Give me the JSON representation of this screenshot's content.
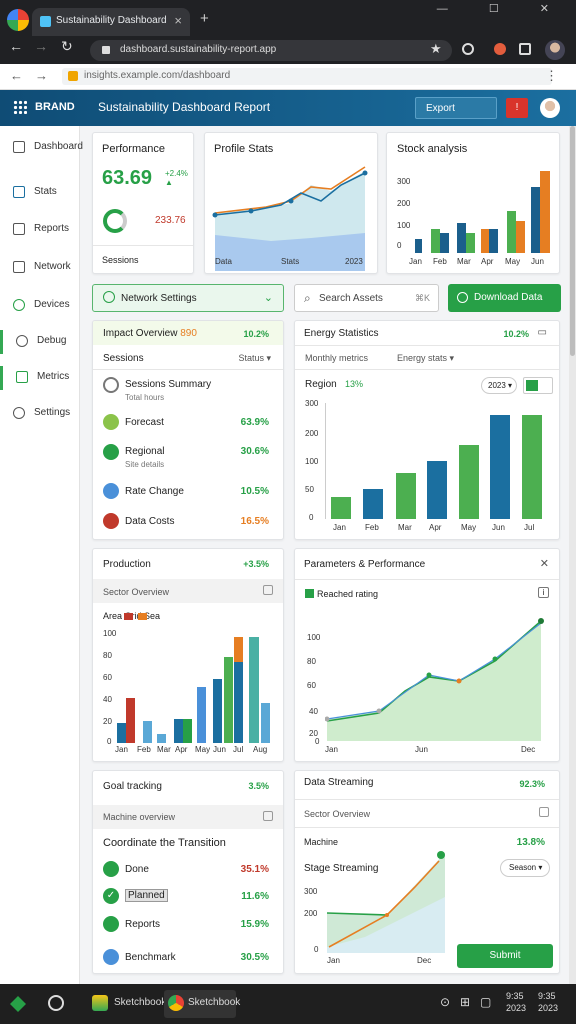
{
  "browser": {
    "tab_title": "Sustainability Dashboard",
    "url": "dashboard.sustainability-report.app",
    "window_controls": "— ☐ ✕"
  },
  "subbar": {
    "url": "insights.example.com/dashboard"
  },
  "header": {
    "brand": "BRAND",
    "title": "Sustainability Dashboard Report",
    "button_label": "Export",
    "alert_label": "!"
  },
  "sidebar": {
    "items": [
      {
        "label": "Dashboard",
        "icon": "dashboard-icon"
      },
      {
        "label": "Stats",
        "icon": "stats-icon"
      },
      {
        "label": "Reports",
        "icon": "reports-icon"
      },
      {
        "label": "Network",
        "icon": "network-icon"
      },
      {
        "label": "Devices",
        "icon": "devices-icon"
      },
      {
        "label": "Debug",
        "icon": "debug-icon"
      },
      {
        "label": "Metrics",
        "icon": "metrics-icon"
      },
      {
        "label": "Settings",
        "icon": "settings-icon"
      }
    ]
  },
  "card_overview": {
    "title": "Performance",
    "value": "63.69",
    "delta": "+2.4% ▲",
    "stat": "233.76",
    "footer": "Sessions"
  },
  "card_trend": {
    "title": "Profile Stats",
    "axis_left": "Data",
    "axis_mid": "Stats",
    "axis_right": "2023"
  },
  "card_bars_small": {
    "title": "Stock analysis",
    "ylabels": [
      "300",
      "200",
      "100",
      "0"
    ],
    "categories": [
      "Jan",
      "Feb",
      "Mar",
      "Apr",
      "May",
      "Jun"
    ]
  },
  "filters": {
    "dropdown_label": "Network Settings",
    "search_placeholder": "Search Assets",
    "search_shortcut": "⌘K",
    "button_label": "Download Data"
  },
  "card_list": {
    "title_prefix": "Impact Overview",
    "title_value": "890",
    "title_pct": "10.2%",
    "subhead_left": "Sessions",
    "subhead_right": "Status ▾",
    "items": [
      {
        "label": "Sessions Summary",
        "sub": "Total hours",
        "pct": "",
        "color": "#777"
      },
      {
        "label": "Forecast",
        "sub": "",
        "pct": "63.9%",
        "color": "#8bc34a"
      },
      {
        "label": "Regional",
        "sub": "Site details",
        "pct": "30.6%",
        "color": "#27a047"
      },
      {
        "label": "Rate Change",
        "sub": "",
        "pct": "10.5%",
        "color": "#4a90d9"
      },
      {
        "label": "Data Costs",
        "sub": "",
        "pct": "16.5%",
        "color": "#c0392b"
      }
    ]
  },
  "card_bars_big": {
    "title": "Energy Statistics",
    "pct": "10.2%",
    "subhead_left": "Monthly metrics",
    "subhead_right": "Energy stats ▾",
    "chart_title": "Region",
    "chart_tag": "13%",
    "select_label": "2023 ▾",
    "ylabels": [
      "300",
      "200",
      "100",
      "50",
      "0"
    ],
    "categories": [
      "Jan",
      "Feb",
      "Mar",
      "Apr",
      "May",
      "Jun",
      "Jul"
    ]
  },
  "card_grouped": {
    "title": "Production",
    "pct": "+3.5%",
    "subhead": "Sector Overview",
    "legend": "Area  Grid  Sea",
    "ylabels": [
      "100",
      "80",
      "60",
      "40",
      "20",
      "0"
    ],
    "categories": [
      "Jan",
      "Feb",
      "Mar",
      "Apr",
      "May",
      "Jun",
      "Jul",
      "Aug"
    ]
  },
  "card_area": {
    "title": "Parameters & Performance",
    "legend": "Reached rating",
    "ylabels": [
      "100",
      "80",
      "60",
      "40",
      "20",
      "0"
    ],
    "x_left": "Jan",
    "x_mid": "Jun",
    "x_right": "Dec"
  },
  "card_tasks": {
    "title": "Goal tracking",
    "pct": "3.5%",
    "subhead": "Machine overview",
    "heading": "Coordinate the Transition",
    "items": [
      {
        "label": "Done",
        "pct": "35.1%",
        "pct_color": "#c0392b",
        "ic_color": "#27a047"
      },
      {
        "label": "Planned",
        "pct": "11.6%",
        "pct_color": "#27a047",
        "ic_color": "#27a047"
      },
      {
        "label": "Reports",
        "pct": "15.9%",
        "pct_color": "#27a047",
        "ic_color": "#27a047"
      },
      {
        "label": "Benchmark",
        "pct": "30.5%",
        "pct_color": "#27a047",
        "ic_color": "#4a90d9"
      }
    ]
  },
  "card_forecast": {
    "title": "Data Streaming",
    "pct": "92.3%",
    "subhead": "Sector Overview",
    "row_label": "Machine",
    "row_pct": "13.8%",
    "chart_title": "Stage Streaming",
    "select_label": "Season ▾",
    "ylabels": [
      "300",
      "200",
      "0"
    ],
    "x_left": "Jan",
    "x_right": "Dec",
    "button_label": "Submit"
  },
  "taskbar": {
    "app1": "Sketchbook",
    "app2": "Sketchbook",
    "time": "9:35",
    "date": "2023"
  }
}
